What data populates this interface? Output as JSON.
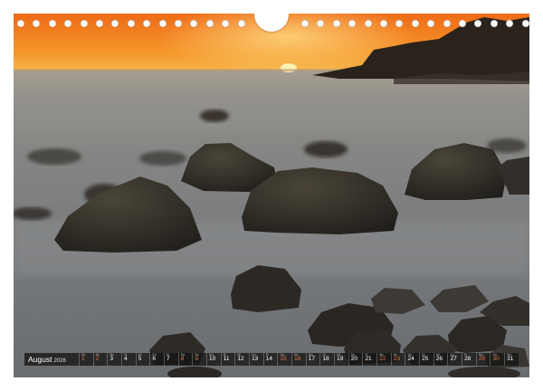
{
  "calendar": {
    "month_label": "August",
    "year_label": "2026",
    "days": [
      {
        "n": "1",
        "w": "Sa"
      },
      {
        "n": "2",
        "w": "So"
      },
      {
        "n": "3",
        "w": "Mo"
      },
      {
        "n": "4",
        "w": "Di"
      },
      {
        "n": "5",
        "w": "Mi"
      },
      {
        "n": "6",
        "w": "Do"
      },
      {
        "n": "7",
        "w": "Fr"
      },
      {
        "n": "8",
        "w": "Sa"
      },
      {
        "n": "9",
        "w": "So"
      },
      {
        "n": "10",
        "w": "Mo"
      },
      {
        "n": "11",
        "w": "Di"
      },
      {
        "n": "12",
        "w": "Mi"
      },
      {
        "n": "13",
        "w": "Do"
      },
      {
        "n": "14",
        "w": "Fr"
      },
      {
        "n": "15",
        "w": "Sa"
      },
      {
        "n": "16",
        "w": "So"
      },
      {
        "n": "17",
        "w": "Mo"
      },
      {
        "n": "18",
        "w": "Di"
      },
      {
        "n": "19",
        "w": "Mi"
      },
      {
        "n": "20",
        "w": "Do"
      },
      {
        "n": "21",
        "w": "Fr"
      },
      {
        "n": "22",
        "w": "Sa"
      },
      {
        "n": "23",
        "w": "So"
      },
      {
        "n": "24",
        "w": "Mo"
      },
      {
        "n": "25",
        "w": "Di"
      },
      {
        "n": "26",
        "w": "Mi"
      },
      {
        "n": "27",
        "w": "Do"
      },
      {
        "n": "28",
        "w": "Fr"
      },
      {
        "n": "29",
        "w": "Sa"
      },
      {
        "n": "30",
        "w": "So"
      },
      {
        "n": "31",
        "w": "Mo"
      }
    ]
  },
  "photo": {
    "subject": "sunset-over-misty-sea-with-rocks",
    "colors": {
      "sky_top": "#f07a1c",
      "sky_horizon": "#f9b03a",
      "sun": "#fff1b0",
      "sea": "#7a7c7d",
      "rocks": "#2e2a26"
    }
  },
  "binding": {
    "hole_count_left": 15,
    "hole_count_right": 15
  }
}
